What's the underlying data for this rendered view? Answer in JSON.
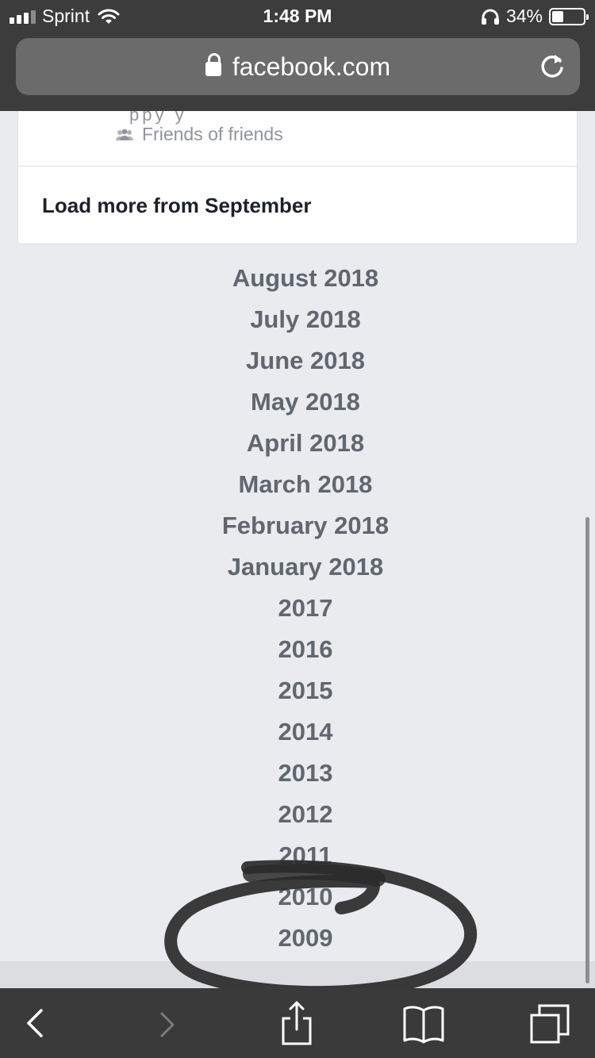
{
  "status_bar": {
    "carrier": "Sprint",
    "time": "1:48 PM",
    "battery_percent": "34%",
    "battery_level": 0.34
  },
  "browser": {
    "url": "facebook.com"
  },
  "post": {
    "clipped_text": "ppy  y",
    "privacy": "Friends of friends"
  },
  "load_more": "Load more from September",
  "archive": [
    "August 2018",
    "July 2018",
    "June 2018",
    "May 2018",
    "April 2018",
    "March 2018",
    "February 2018",
    "January 2018",
    "2017",
    "2016",
    "2015",
    "2014",
    "2013",
    "2012",
    "2011",
    "2010",
    "2009"
  ],
  "colors": {
    "page_bg": "#e9ebee",
    "archive_text": "#606770",
    "chrome_bg": "#3c3c3c",
    "annotation_ink": "#2a2a2a"
  },
  "icons": {
    "toolbar": [
      "back-icon",
      "forward-icon",
      "share-icon",
      "bookmarks-icon",
      "tabs-icon"
    ]
  }
}
